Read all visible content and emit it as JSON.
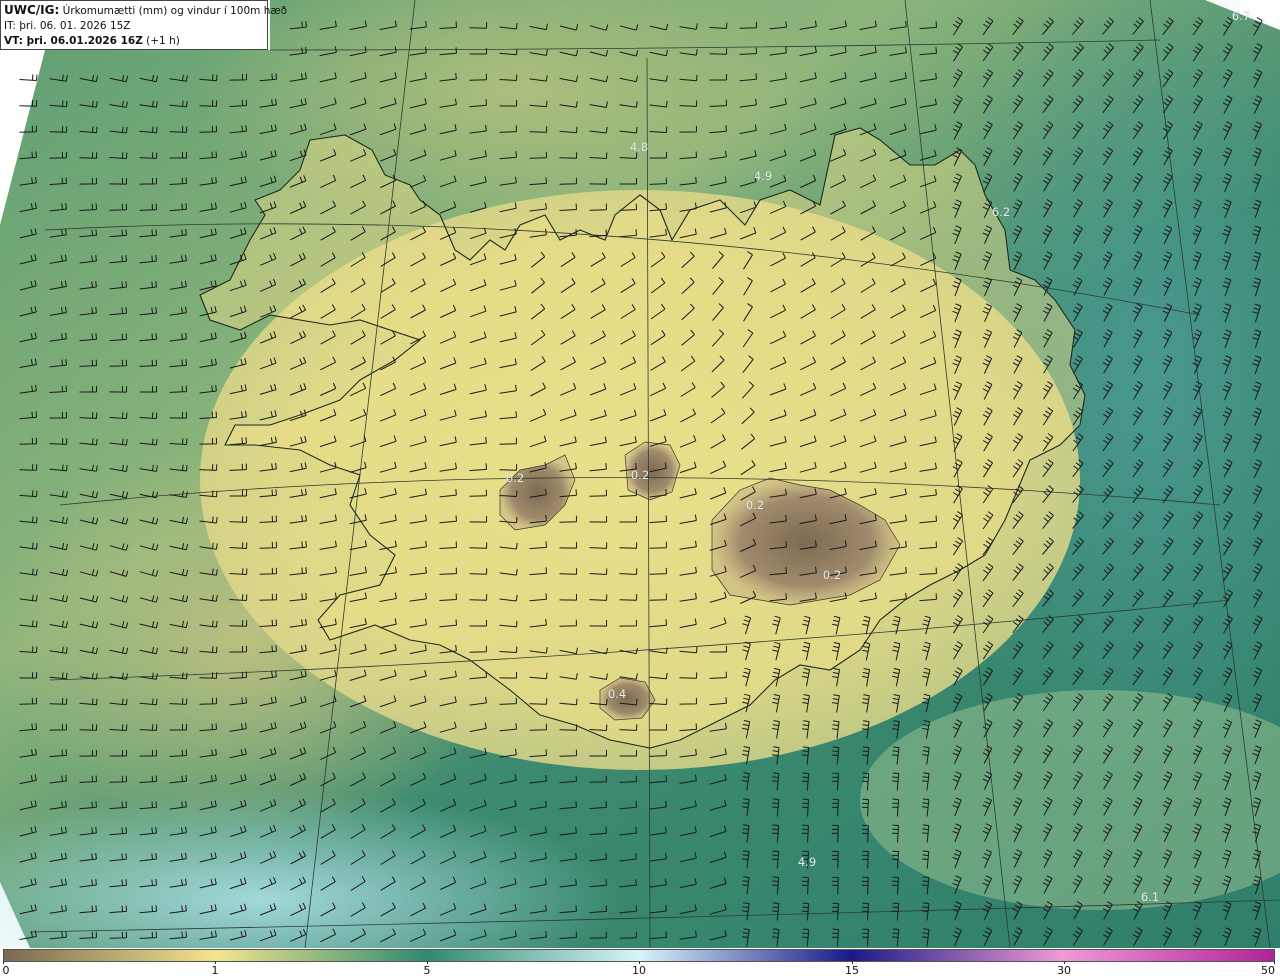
{
  "header": {
    "title_key": "UWC/IG:",
    "title_text": " Úrkomumætti (mm) og vindur í 100m hæð",
    "it_key": "IT:",
    "it_text": " þri. 06. 01. 2026 15Z",
    "vt_key": "VT:",
    "vt_bold": " þri. 06.01.2026 16Z",
    "vt_suffix": " (+1 h)"
  },
  "map": {
    "title": "Úrkomumætti (mm) og vindur í 100m hæð",
    "region": "Iceland",
    "contour_labels": [
      "4.8",
      "4.9",
      "6.2",
      "6.7",
      "0.2",
      "0.2",
      "0.2",
      "0.2",
      "0.4",
      "4.9",
      "6.1"
    ]
  },
  "colorbar": {
    "ticks": [
      "0",
      "1",
      "5",
      "10",
      "15",
      "30",
      "50"
    ],
    "colors": {
      "0": "#7b6852",
      "1": "#f3e58c",
      "5": "#2f8a6e",
      "10": "#d8f4fb",
      "15": "#1a1a86",
      "30": "#ee9ad6",
      "50": "#b0239a"
    }
  }
}
